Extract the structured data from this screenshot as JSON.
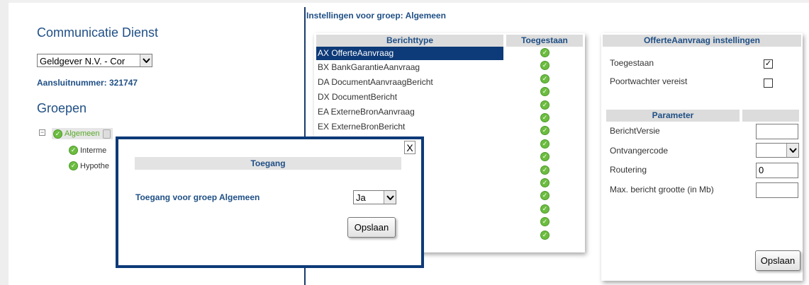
{
  "left": {
    "title": "Communicatie Dienst",
    "lender_select": "Geldgever N.V. - Cor",
    "connection": "Aansluitnummer: 321747",
    "groups_title": "Groepen",
    "tree": {
      "root": "Algemeen",
      "children": [
        "Interme",
        "Hypothe"
      ]
    }
  },
  "center": {
    "heading": "Instellingen voor groep: Algemeen",
    "col_type": "Berichttype",
    "col_allowed": "Toegestaan",
    "rows": [
      "AX OfferteAanvraag",
      "BX BankGarantieAanvraag",
      "DA DocumentAanvraagBericht",
      "DX DocumentBericht",
      "EA ExterneBronAanvraag",
      "EX ExterneBronBericht"
    ],
    "check_count": 15
  },
  "right": {
    "settings_header": "OfferteAanvraag instellingen",
    "allowed_label": "Toegestaan",
    "allowed_checked": "✓",
    "gatekeeper_label": "Poortwachter vereist",
    "param_header": "Parameter",
    "params": [
      {
        "label": "BerichtVersie",
        "value": ""
      },
      {
        "label": "Ontvangercode",
        "value": ""
      },
      {
        "label": "Routering",
        "value": "0"
      },
      {
        "label": "Max. bericht grootte (in Mb)",
        "value": ""
      }
    ],
    "save_label": "Opslaan"
  },
  "modal": {
    "close": "X",
    "title": "Toegang",
    "label": "Toegang voor groep Algemeen",
    "select_value": "Ja",
    "save_label": "Opslaan"
  },
  "colors": {
    "accent": "#1f4f85",
    "selection": "#0d3a78",
    "check_green": "#6cbd3f"
  }
}
